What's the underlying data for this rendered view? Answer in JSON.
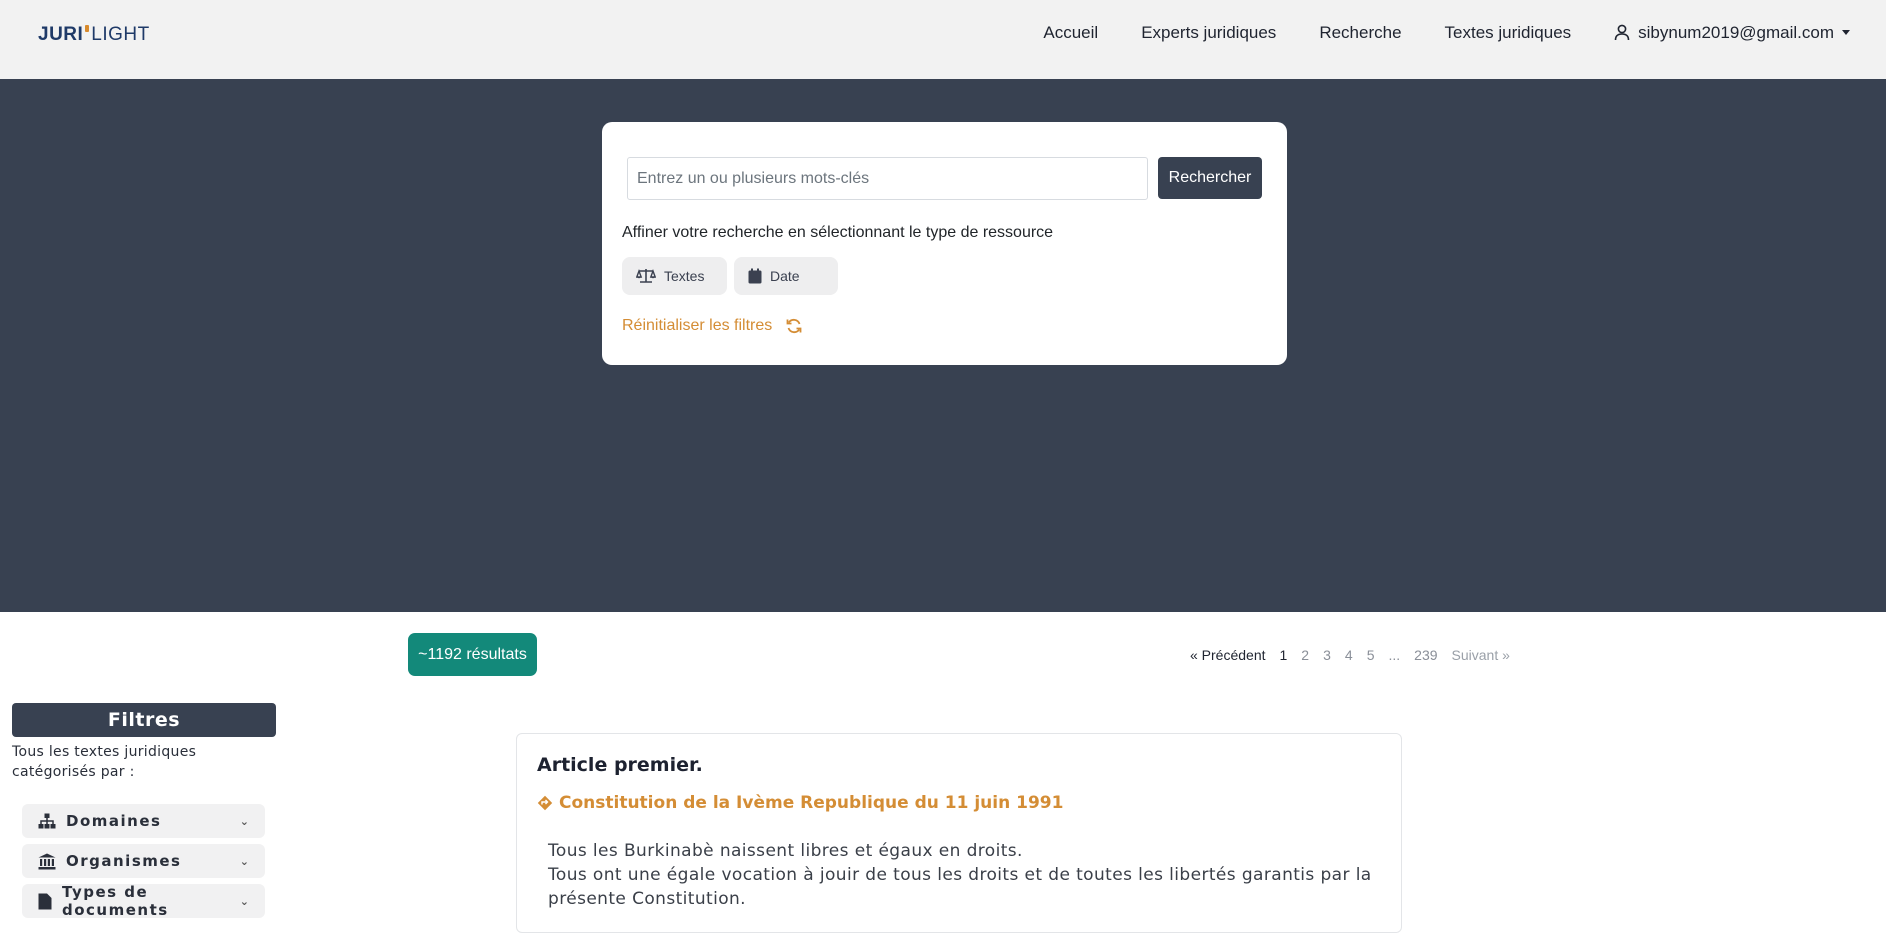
{
  "header": {
    "brand_part1": "JURI",
    "brand_part2": "LIGHT",
    "nav": [
      {
        "label": "Accueil"
      },
      {
        "label": "Experts juridiques"
      },
      {
        "label": "Recherche"
      },
      {
        "label": "Textes juridiques"
      }
    ],
    "user_email": "sibynum2019@gmail.com",
    "user_icon": "user-icon"
  },
  "search": {
    "placeholder": "Entrez un ou plusieurs mots-clés",
    "button_label": "Rechercher",
    "refine_text": "Affiner votre recherche en sélectionnant le type de ressource",
    "filters": [
      {
        "label": "Textes",
        "icon": "balance-scale-icon"
      },
      {
        "label": "Date",
        "icon": "calendar-icon"
      }
    ],
    "reset_label": "Réinitialiser les filtres",
    "reset_icon": "refresh-icon"
  },
  "results": {
    "count_label": "~1192 résultats",
    "pagination": {
      "prev": "« Précédent",
      "pages": [
        "1",
        "2",
        "3",
        "4",
        "5",
        "...",
        "239"
      ],
      "current": "1",
      "next": "Suivant »"
    }
  },
  "sidebar": {
    "title": "Filtres",
    "description": "Tous les textes juridiques catégorisés par :",
    "items": [
      {
        "label": "Domaines",
        "icon": "sitemap-icon"
      },
      {
        "label": "Organismes",
        "icon": "bank-icon"
      },
      {
        "label": "Types de documents",
        "icon": "file-icon"
      }
    ]
  },
  "result_item": {
    "title": "Article premier.",
    "source": "Constitution de la Ivème Republique du 11 juin 1991",
    "source_icon": "diamond-arrow-icon",
    "body_lines": [
      "Tous les Burkinabè naissent libres et égaux en droits.",
      "Tous ont une égale vocation à jouir de tous les droits et de toutes les libertés garantis par la",
      "présente Constitution."
    ]
  },
  "colors": {
    "header_bg": "#f2f2f2",
    "hero_bg": "#384151",
    "accent_orange": "#d48d35",
    "badge_green": "#13897a",
    "brand_blue": "#1f3a68"
  }
}
